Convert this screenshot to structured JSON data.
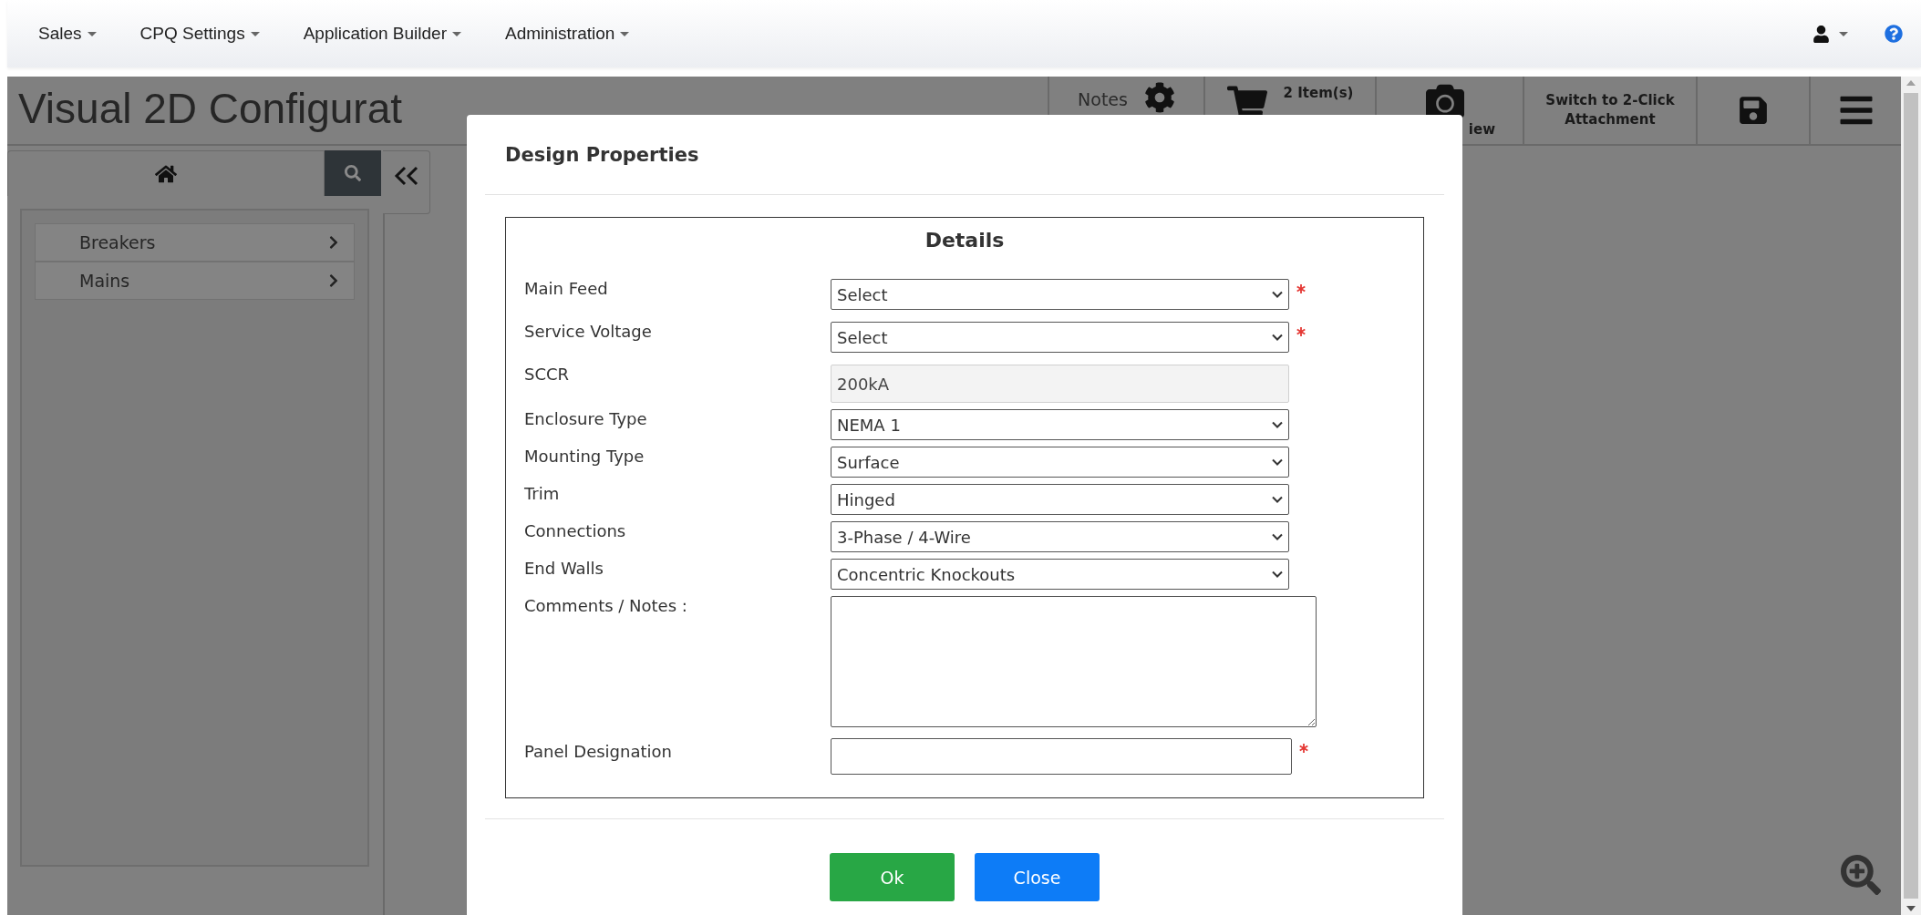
{
  "nav": {
    "menus": [
      {
        "label": "Sales"
      },
      {
        "label": "CPQ Settings"
      },
      {
        "label": "Application Builder"
      },
      {
        "label": "Administration"
      }
    ]
  },
  "header": {
    "title": "Visual 2D Configurat",
    "toolbar": [
      {
        "kind": "notes",
        "label": "Notes"
      },
      {
        "kind": "cart",
        "label": "2 Item(s)"
      },
      {
        "kind": "camera",
        "label": "iew"
      },
      {
        "kind": "text",
        "label": "Switch to 2-Click Attachment"
      },
      {
        "kind": "save"
      },
      {
        "kind": "menu"
      }
    ]
  },
  "sidebar": {
    "items": [
      {
        "label": "Breakers"
      },
      {
        "label": "Mains"
      }
    ]
  },
  "dialog": {
    "title": "Design Properties",
    "section_title": "Details",
    "fields": [
      {
        "label": "Main Feed",
        "kind": "select",
        "value": "Select",
        "required": true
      },
      {
        "label": "Service Voltage",
        "kind": "select",
        "value": "Select",
        "required": true
      },
      {
        "label": "SCCR",
        "kind": "readonly",
        "value": "200kA",
        "required": false
      },
      {
        "label": "Enclosure Type",
        "kind": "select",
        "value": "NEMA 1",
        "required": false
      },
      {
        "label": "Mounting Type",
        "kind": "select",
        "value": "Surface",
        "required": false
      },
      {
        "label": "Trim",
        "kind": "select",
        "value": "Hinged",
        "required": false
      },
      {
        "label": "Connections",
        "kind": "select",
        "value": "3-Phase / 4-Wire",
        "required": false
      },
      {
        "label": "End Walls",
        "kind": "select",
        "value": "Concentric Knockouts",
        "required": false
      },
      {
        "label": "Comments / Notes :",
        "kind": "textarea",
        "required": false
      },
      {
        "label": "Panel Designation",
        "kind": "text",
        "required": true
      }
    ],
    "buttons": [
      {
        "label": "Ok",
        "kind": "primary"
      },
      {
        "label": "Close",
        "kind": "secondary"
      }
    ]
  }
}
